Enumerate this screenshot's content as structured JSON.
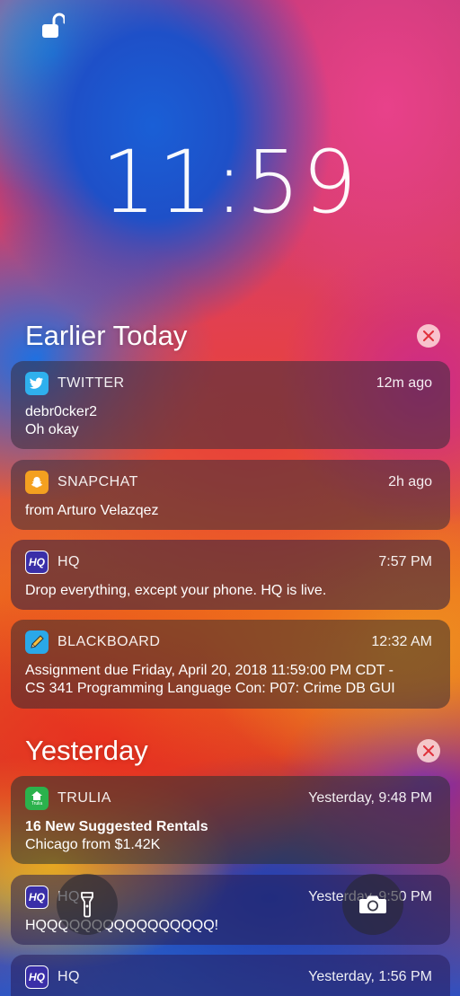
{
  "clock": {
    "time": "11:59"
  },
  "sections": [
    {
      "title": "Earlier Today"
    },
    {
      "title": "Yesterday"
    }
  ],
  "notifications": [
    {
      "app": "TWITTER",
      "time": "12m ago",
      "line1": "debr0cker2",
      "line2": "Oh okay",
      "icon": "twitter-bird-icon",
      "color": "#2fb0ee"
    },
    {
      "app": "SNAPCHAT",
      "time": "2h ago",
      "line1": "from Arturo Velazqez",
      "icon": "snapchat-ghost-icon",
      "color": "#f4a020"
    },
    {
      "app": "HQ",
      "time": "7:57 PM",
      "line1": "Drop everything, except your phone. HQ is live.",
      "icon": "hq-icon",
      "color": "#3a2fa8"
    },
    {
      "app": "BLACKBOARD",
      "time": "12:32 AM",
      "line1": "Assignment due Friday, April 20, 2018 11:59:00 PM CDT -",
      "line2": "CS 341 Programming Language Con: P07: Crime DB GUI",
      "icon": "blackboard-pencil-icon",
      "color": "#2aa8e8"
    },
    {
      "app": "TRULIA",
      "time": "Yesterday, 9:48 PM",
      "line1": "16 New Suggested Rentals",
      "line2": "Chicago from $1.42K",
      "icon": "trulia-house-icon",
      "color": "#2bb24c",
      "icon_label": "Trulia"
    },
    {
      "app": "HQ",
      "time": "Yesterday, 9:50 PM",
      "line1": "HQQQQQQQQQQQQQQQQ!",
      "icon": "hq-icon",
      "color": "#3a2fa8"
    },
    {
      "app": "HQ",
      "time": "Yesterday, 1:56 PM",
      "line1": "",
      "icon": "hq-icon",
      "color": "#3a2fa8"
    }
  ],
  "hq_icon_text": "HQ",
  "buttons": {
    "flashlight": "flashlight-icon",
    "camera": "camera-icon"
  }
}
